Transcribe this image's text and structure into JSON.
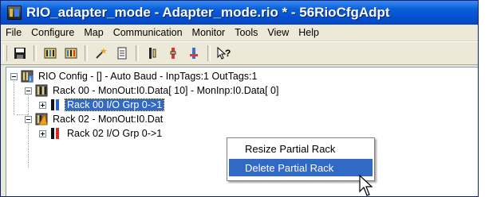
{
  "window": {
    "title": "RIO_adapter_mode - Adapter_mode.rio * - 56RioCfgAdpt"
  },
  "menubar": {
    "items": [
      "File",
      "Configure",
      "Map",
      "Communication",
      "Monitor",
      "Tools",
      "View",
      "Help"
    ]
  },
  "toolbar": {
    "buttons": [
      "save-icon",
      "rack-config-icon",
      "rack-edit-icon",
      "wizard-icon",
      "report-icon",
      "io-module-icon",
      "io-module-red-icon",
      "io-module-blue-icon",
      "help-cursor-icon"
    ]
  },
  "tree": {
    "root": "RIO Config - [] - Auto Baud - InpTags:1 OutTags:1",
    "rack00": "Rack 00 - MonOut:I0.Data[ 10] - MonInp:I0.Data[ 0]",
    "rack00_grp": "Rack 00 I/O Grp 0->1",
    "rack02": "Rack 02 - MonOut:I0.Dat",
    "rack02_grp": "Rack 02 I/O Grp 0->1"
  },
  "context_menu": {
    "items": [
      "Resize Partial Rack",
      "Delete Partial Rack"
    ],
    "highlighted_index": 1
  },
  "colors": {
    "titlebar": "#0550d0",
    "selection": "#316ac5"
  }
}
